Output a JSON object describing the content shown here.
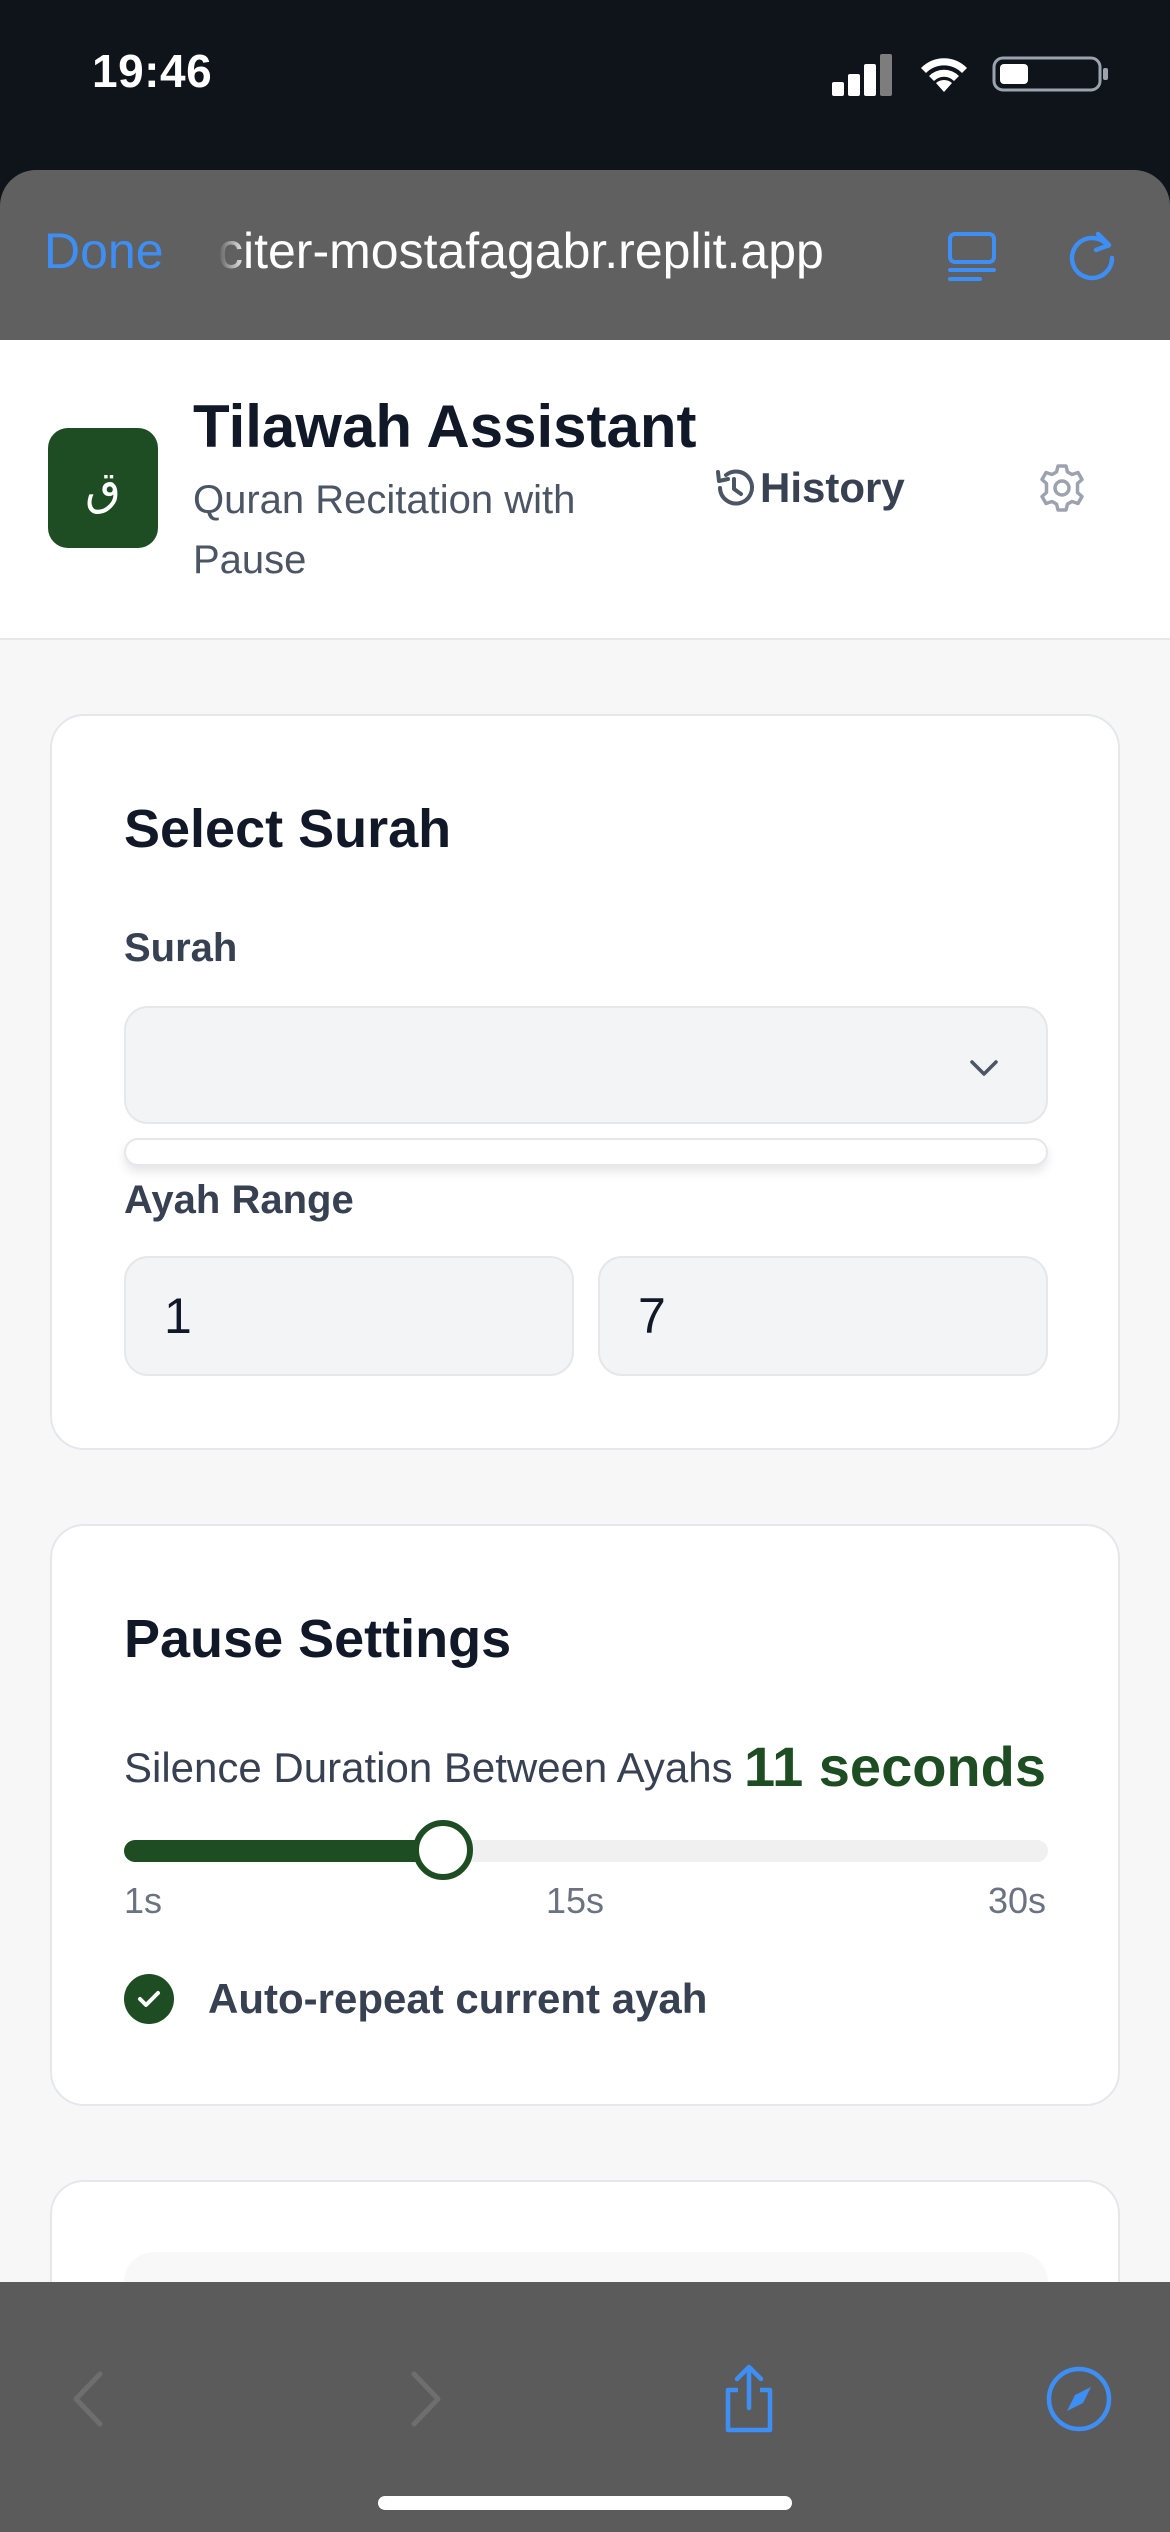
{
  "status_bar": {
    "time": "19:46"
  },
  "browser": {
    "done_label": "Done",
    "url": "citer-mostafagabr.replit.app"
  },
  "header": {
    "logo_char": "ق",
    "title": "Tilawah Assistant",
    "subtitle": "Quran Recitation with Pause",
    "history_label": "History"
  },
  "select_surah": {
    "title": "Select Surah",
    "surah_label": "Surah",
    "surah_value": "",
    "ayah_range_label": "Ayah Range",
    "ayah_from": "1",
    "ayah_to": "7"
  },
  "pause_settings": {
    "title": "Pause Settings",
    "silence_label": "Silence Duration Between Ayahs",
    "silence_value_text": "11 seconds",
    "slider": {
      "min": 1,
      "max": 30,
      "value": 11
    },
    "ticks": [
      "1s",
      "15s",
      "30s"
    ],
    "auto_repeat_label": "Auto-repeat current ayah",
    "auto_repeat_checked": true
  },
  "colors": {
    "accent_green": "#1f4d23",
    "link_blue": "#3e8ff5"
  }
}
